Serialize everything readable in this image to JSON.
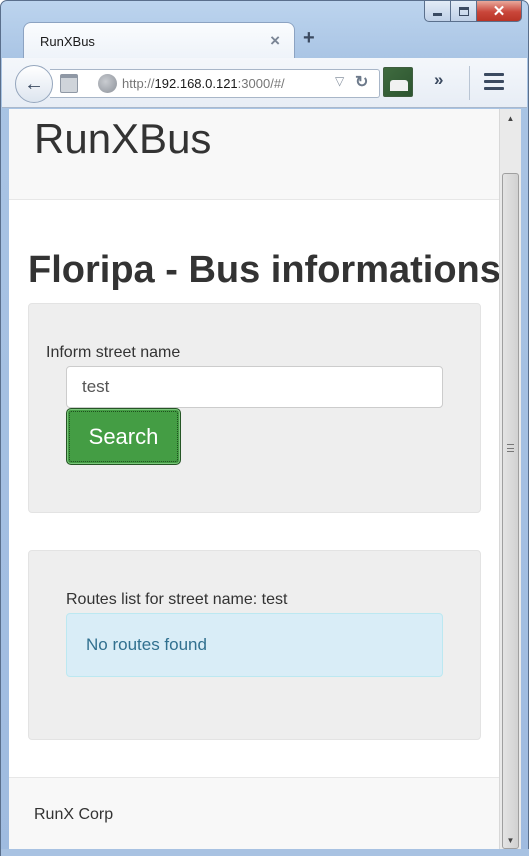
{
  "browser": {
    "tab_title": "RunXBus",
    "tab_close_glyph": "×",
    "new_tab_glyph": "+",
    "url_prefix": "http://",
    "url_host": "192.168.0.121",
    "url_suffix": ":3000/#/",
    "back_glyph": "←",
    "reload_glyph": "↻",
    "dropdown_glyph": "▽",
    "overflow_glyph": "»",
    "caption_close_glyph": "✕"
  },
  "navbar": {
    "brand": "RunXBus"
  },
  "main": {
    "title": "Floripa - Bus informations",
    "search_form": {
      "label": "Inform street name",
      "input_value": "test",
      "button_label": "Search"
    },
    "routes": {
      "label": "Routes list for street name: test",
      "empty_message": "No routes found"
    }
  },
  "footer": {
    "text": "RunX Corp"
  },
  "colors": {
    "button_success": "#449d44",
    "alert_info_bg": "#d9edf7",
    "alert_info_text": "#31708f",
    "well_bg": "#eeeeee"
  },
  "icons": [
    "back-icon",
    "identity-icon",
    "globe-icon",
    "reload-icon",
    "extension-icon",
    "overflow-icon",
    "hamburger-menu-icon",
    "close-icon"
  ]
}
